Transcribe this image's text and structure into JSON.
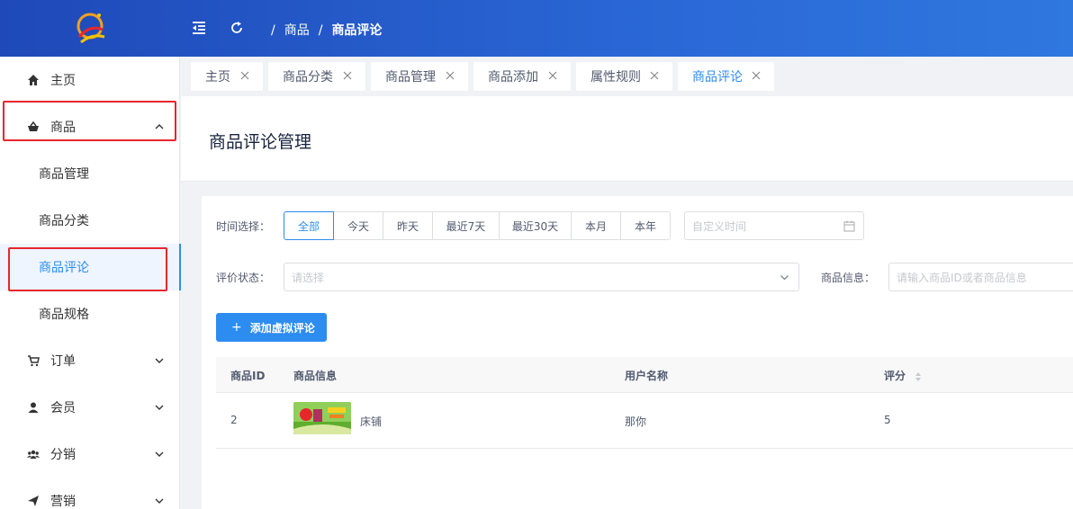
{
  "header": {
    "breadcrumb": [
      "商品",
      "商品评论"
    ],
    "separator": "/"
  },
  "sidebar": {
    "items": [
      {
        "label": "主页",
        "icon": "home-icon"
      },
      {
        "label": "商品",
        "icon": "basket-icon",
        "expanded": true
      },
      {
        "label": "订单",
        "icon": "cart-icon"
      },
      {
        "label": "会员",
        "icon": "user-icon"
      },
      {
        "label": "分销",
        "icon": "team-icon"
      },
      {
        "label": "营销",
        "icon": "send-icon"
      }
    ],
    "sub_items": [
      {
        "label": "商品管理"
      },
      {
        "label": "商品分类"
      },
      {
        "label": "商品评论",
        "active": true
      },
      {
        "label": "商品规格"
      }
    ]
  },
  "tabs": [
    {
      "label": "主页"
    },
    {
      "label": "商品分类"
    },
    {
      "label": "商品管理"
    },
    {
      "label": "商品添加"
    },
    {
      "label": "属性规则"
    },
    {
      "label": "商品评论",
      "active": true
    }
  ],
  "page": {
    "title": "商品评论管理"
  },
  "filters": {
    "time_label": "时间选择：",
    "time_options": [
      "全部",
      "今天",
      "昨天",
      "最近7天",
      "最近30天",
      "本月",
      "本年"
    ],
    "time_selected": "全部",
    "custom_time_placeholder": "自定义时间",
    "status_label": "评价状态：",
    "status_placeholder": "请选择",
    "product_label": "商品信息：",
    "product_placeholder": "请输入商品ID或者商品信息"
  },
  "actions": {
    "add_virtual_review": "添加虚拟评论"
  },
  "table": {
    "columns": [
      "商品ID",
      "商品信息",
      "用户名称",
      "评分"
    ],
    "rows": [
      {
        "product_id": "2",
        "product_name": "床铺",
        "user_name": "那你",
        "score": "5"
      }
    ]
  },
  "colors": {
    "accent": "#2d8cf0",
    "header_start": "#1f49b8",
    "header_end": "#2f78df",
    "highlight_box": "#e8262d"
  }
}
